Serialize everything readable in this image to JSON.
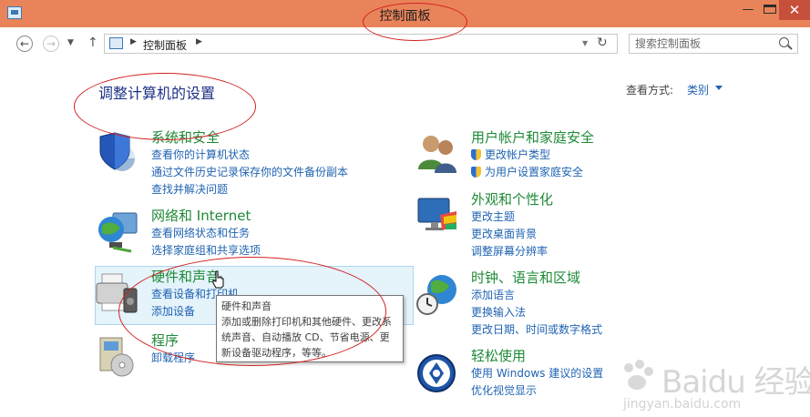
{
  "window": {
    "title": "控制面板"
  },
  "nav": {
    "crumb": "控制面板"
  },
  "search": {
    "placeholder": "搜索控制面板"
  },
  "header": {
    "title": "调整计算机的设置",
    "view_label": "查看方式:",
    "view_value": "类别"
  },
  "categories": [
    {
      "title": "系统和安全",
      "links": [
        "查看你的计算机状态",
        "通过文件历史记录保存你的文件备份副本",
        "查找并解决问题"
      ]
    },
    {
      "title": "网络和 Internet",
      "links": [
        "查看网络状态和任务",
        "选择家庭组和共享选项"
      ]
    },
    {
      "title": "硬件和声音",
      "links": [
        "查看设备和打印机",
        "添加设备"
      ]
    },
    {
      "title": "程序",
      "links": [
        "卸载程序"
      ]
    },
    {
      "title": "用户帐户和家庭安全",
      "links": [
        "更改帐户类型",
        "为用户设置家庭安全"
      ]
    },
    {
      "title": "外观和个性化",
      "links": [
        "更改主题",
        "更改桌面背景",
        "调整屏幕分辨率"
      ]
    },
    {
      "title": "时钟、语言和区域",
      "links": [
        "添加语言",
        "更换输入法",
        "更改日期、时间或数字格式"
      ]
    },
    {
      "title": "轻松使用",
      "links": [
        "使用 Windows 建议的设置",
        "优化视觉显示"
      ]
    }
  ],
  "tooltip": {
    "title": "硬件和声音",
    "body": "添加或删除打印机和其他硬件、更改系统声音、自动播放 CD、节省电源、更新设备驱动程序，等等。"
  },
  "watermark": {
    "text": "Baidu 经验",
    "sub": "jingyan.baidu.com"
  },
  "colors": {
    "titlebar": "#e9845a",
    "category_title": "#1e8a37",
    "link": "#1f63b2",
    "annotation": "#d32222"
  }
}
